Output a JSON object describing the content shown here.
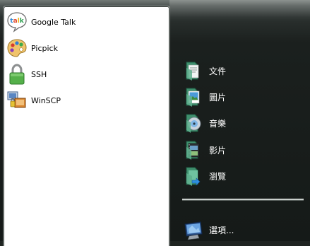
{
  "programs": [
    {
      "label": "Google Talk",
      "icon": "google-talk-icon"
    },
    {
      "label": "Picpick",
      "icon": "picpick-palette-icon"
    },
    {
      "label": "SSH",
      "icon": "ssh-lock-icon"
    },
    {
      "label": "WinSCP",
      "icon": "winscp-icon"
    }
  ],
  "places": [
    {
      "label": "文件",
      "icon": "documents-folder-icon"
    },
    {
      "label": "圖片",
      "icon": "pictures-folder-icon"
    },
    {
      "label": "音樂",
      "icon": "music-folder-icon"
    },
    {
      "label": "影片",
      "icon": "videos-folder-icon"
    },
    {
      "label": "瀏覽",
      "icon": "browse-folder-icon"
    }
  ],
  "options": {
    "label": "選項...",
    "icon": "options-monitor-icon"
  },
  "colors": {
    "panel_background": "#ffffff",
    "dark_background": "#1b201e",
    "right_text": "#ffffff",
    "left_text": "#000000"
  }
}
